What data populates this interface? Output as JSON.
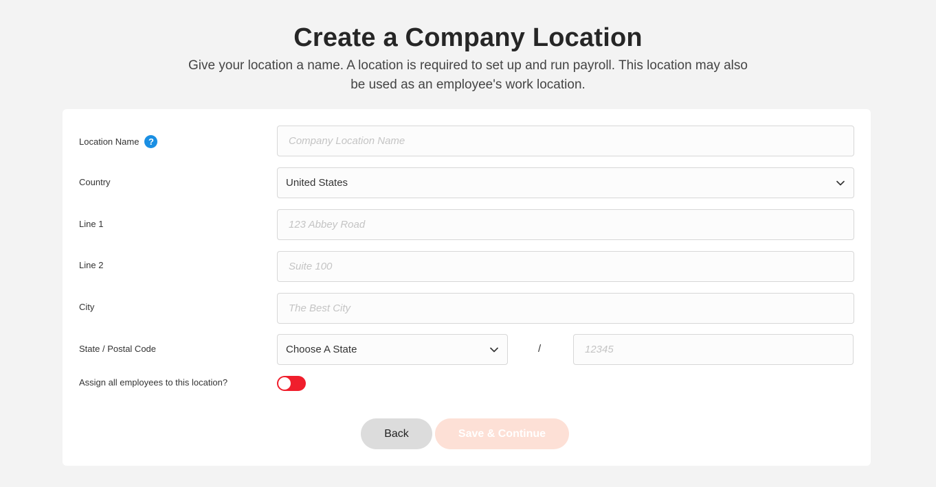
{
  "header": {
    "title": "Create a Company Location",
    "subtitle": "Give your location a name. A location is required to set up and run payroll. This location may also be used as an employee's work location."
  },
  "form": {
    "location_name": {
      "label": "Location Name",
      "placeholder": "Company Location Name",
      "help": "?"
    },
    "country": {
      "label": "Country",
      "value": "United States"
    },
    "line1": {
      "label": "Line 1",
      "placeholder": "123 Abbey Road"
    },
    "line2": {
      "label": "Line 2",
      "placeholder": "Suite 100"
    },
    "city": {
      "label": "City",
      "placeholder": "The Best City"
    },
    "state_postal": {
      "label": "State / Postal Code",
      "state_value": "Choose A State",
      "separator": "/",
      "postal_placeholder": "12345"
    },
    "assign_all": {
      "label": "Assign all employees to this location?",
      "enabled": false
    }
  },
  "actions": {
    "back_label": "Back",
    "save_label": "Save & Continue"
  },
  "colors": {
    "accent": "#f01e2c",
    "help": "#1a8fe3",
    "save_disabled": "#fde0d6"
  },
  "icons": {
    "help": "question-icon",
    "dropdown": "chevron-down-icon"
  }
}
